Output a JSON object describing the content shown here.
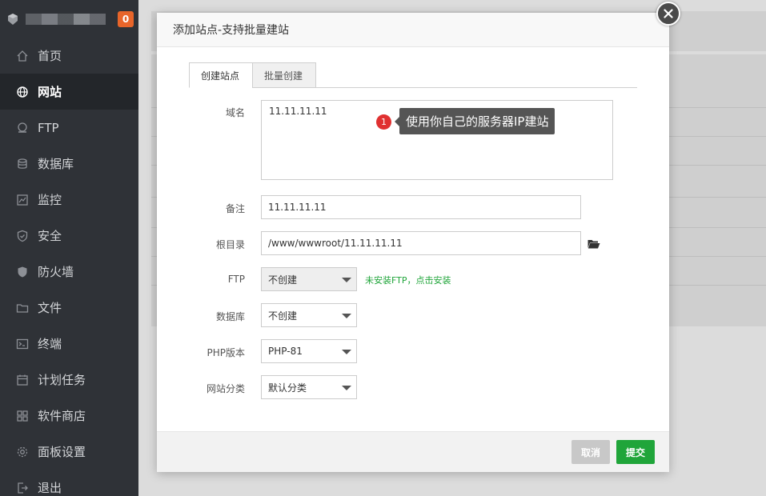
{
  "sidebar": {
    "badge": "0",
    "items": [
      {
        "label": "首页",
        "icon": "home-icon"
      },
      {
        "label": "网站",
        "icon": "globe-icon",
        "active": true
      },
      {
        "label": "FTP",
        "icon": "ftp-icon"
      },
      {
        "label": "数据库",
        "icon": "database-icon"
      },
      {
        "label": "监控",
        "icon": "monitor-icon"
      },
      {
        "label": "安全",
        "icon": "shield-icon"
      },
      {
        "label": "防火墙",
        "icon": "firewall-icon"
      },
      {
        "label": "文件",
        "icon": "folder-icon"
      },
      {
        "label": "终端",
        "icon": "terminal-icon"
      },
      {
        "label": "计划任务",
        "icon": "calendar-icon"
      },
      {
        "label": "软件商店",
        "icon": "apps-icon"
      },
      {
        "label": "面板设置",
        "icon": "gear-icon"
      },
      {
        "label": "退出",
        "icon": "logout-icon"
      }
    ]
  },
  "modal": {
    "title": "添加站点-支持批量建站",
    "tabs": [
      {
        "label": "创建站点",
        "active": true
      },
      {
        "label": "批量创建",
        "active": false
      }
    ],
    "form": {
      "domain_label": "域名",
      "domain_value": "11.11.11.11",
      "remark_label": "备注",
      "remark_value": "11.11.11.11",
      "root_label": "根目录",
      "root_value": "/www/wwwroot/11.11.11.11",
      "ftp_label": "FTP",
      "ftp_value": "不创建",
      "ftp_note": "未安装FTP，点击安装",
      "db_label": "数据库",
      "db_value": "不创建",
      "php_label": "PHP版本",
      "php_value": "PHP-81",
      "category_label": "网站分类",
      "category_value": "默认分类"
    },
    "tooltip": {
      "step": "1",
      "text": "使用你自己的服务器IP建站"
    },
    "footer": {
      "cancel_label": "取消",
      "submit_label": "提交"
    }
  },
  "colors": {
    "sidebar_bg": "#2f3237",
    "accent_green": "#20a53a",
    "badge_orange": "#e8652a",
    "tooltip_bg": "#555555",
    "step_red": "#e03131"
  }
}
